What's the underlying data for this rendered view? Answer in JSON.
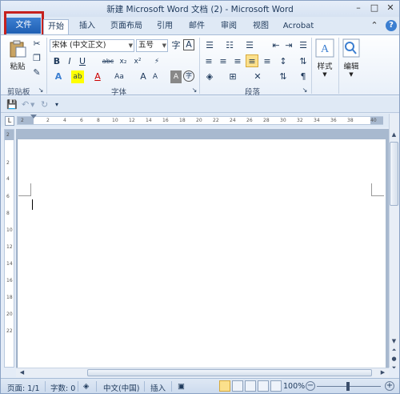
{
  "window": {
    "title": "新建 Microsoft Word 文档 (2) - Microsoft Word"
  },
  "tabs": [
    {
      "label": "文件"
    },
    {
      "label": "开始"
    },
    {
      "label": "插入"
    },
    {
      "label": "页面布局"
    },
    {
      "label": "引用"
    },
    {
      "label": "邮件"
    },
    {
      "label": "审阅"
    },
    {
      "label": "视图"
    },
    {
      "label": "Acrobat"
    }
  ],
  "ribbon": {
    "clipboard": {
      "paste_label": "粘贴",
      "group_label": "剪贴板"
    },
    "font": {
      "font_name": "宋体 (中文正文)",
      "font_size": "五号",
      "group_label": "字体",
      "bold": "B",
      "italic": "I",
      "underline": "U",
      "strikethrough": "abc",
      "subscript": "x₂",
      "superscript": "x²",
      "grow": "A",
      "shrink": "A",
      "case": "Aa",
      "font_color": "A",
      "highlight": "ab",
      "clear_format": "A",
      "phonetic": "字",
      "char_border": "A"
    },
    "paragraph": {
      "group_label": "段落"
    },
    "styles": {
      "label": "样式"
    },
    "editing": {
      "label": "编辑"
    }
  },
  "ruler": {
    "marks": [
      "2",
      "2",
      "4",
      "6",
      "8",
      "10",
      "12",
      "14",
      "16",
      "18",
      "20",
      "22",
      "24",
      "26",
      "28",
      "30",
      "32",
      "34",
      "36",
      "38",
      "40"
    ]
  },
  "vruler": {
    "marks": [
      "2",
      "2",
      "4",
      "6",
      "8",
      "10",
      "12",
      "14",
      "16",
      "18",
      "20",
      "22"
    ]
  },
  "status": {
    "page": "页面: 1/1",
    "words": "字数: 0",
    "language": "中文(中国)",
    "mode": "插入",
    "zoom": "100%"
  },
  "colors": {
    "file_tab": "#2b6ac0",
    "highlight_box": "#c5211f"
  }
}
